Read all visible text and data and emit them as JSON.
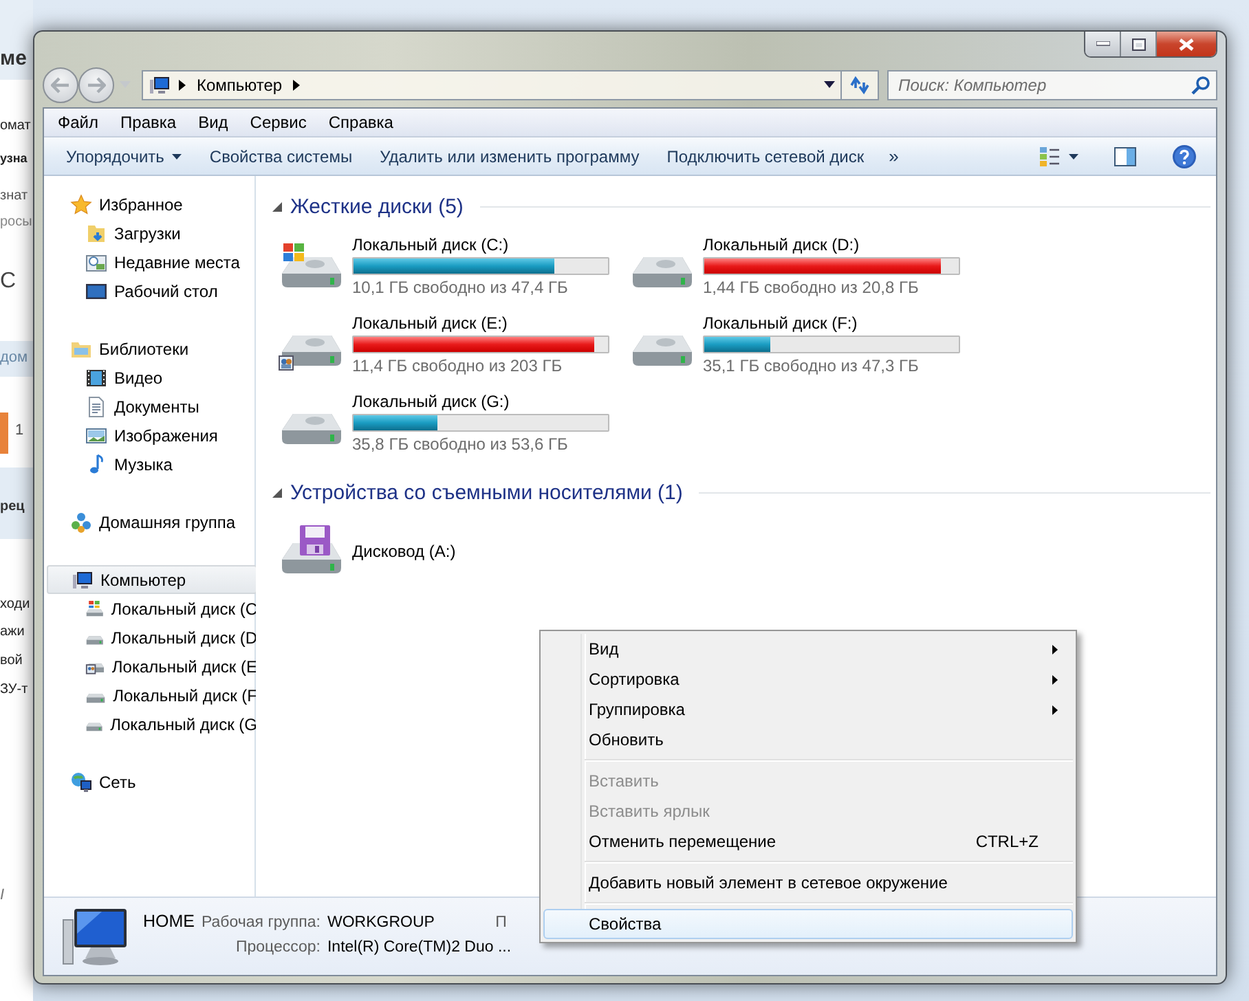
{
  "background_page": {
    "fragments": [
      "ме",
      "омат",
      "узна",
      "знат",
      "росы",
      "С",
      "дом",
      "1",
      "рец",
      "ходи",
      "ажи",
      "вой",
      "ЗУ-т",
      "I"
    ]
  },
  "window": {
    "address": {
      "breadcrumbs": [
        "Компьютер"
      ]
    },
    "search": {
      "placeholder": "Поиск: Компьютер"
    },
    "menu_bar": [
      "Файл",
      "Правка",
      "Вид",
      "Сервис",
      "Справка"
    ],
    "toolbar": [
      {
        "kind": "dropdown",
        "label": "Упорядочить"
      },
      {
        "kind": "button",
        "label": "Свойства системы"
      },
      {
        "kind": "button",
        "label": "Удалить или изменить программу"
      },
      {
        "kind": "button",
        "label": "Подключить сетевой диск"
      },
      {
        "kind": "overflow",
        "label": "»"
      }
    ],
    "sidebar": {
      "items": [
        {
          "kind": "favorites",
          "label": "Избранное",
          "selected": false,
          "children": [
            {
              "kind": "downloads",
              "label": "Загрузки",
              "selected": false
            },
            {
              "kind": "recent",
              "label": "Недавние места",
              "selected": false
            },
            {
              "kind": "desktop",
              "label": "Рабочий стол",
              "selected": false
            }
          ]
        },
        {
          "kind": "libraries",
          "label": "Библиотеки",
          "selected": false,
          "children": [
            {
              "kind": "video",
              "label": "Видео",
              "selected": false
            },
            {
              "kind": "documents",
              "label": "Документы",
              "selected": false
            },
            {
              "kind": "pictures",
              "label": "Изображения",
              "selected": false
            },
            {
              "kind": "music",
              "label": "Музыка",
              "selected": false
            }
          ]
        },
        {
          "kind": "homegroup",
          "label": "Домашняя группа",
          "selected": false
        },
        {
          "kind": "computer",
          "label": "Компьютер",
          "selected": true,
          "children": [
            {
              "kind": "system-drive",
              "label": "Локальный диск (C",
              "selected": false
            },
            {
              "kind": "drive",
              "label": "Локальный диск (D",
              "selected": false
            },
            {
              "kind": "shared-drive",
              "label": "Локальный диск (E",
              "selected": false
            },
            {
              "kind": "drive",
              "label": "Локальный диск (F",
              "selected": false
            },
            {
              "kind": "drive",
              "label": "Локальный диск (G",
              "selected": false
            }
          ]
        },
        {
          "kind": "network",
          "label": "Сеть",
          "selected": false
        }
      ]
    },
    "sections": [
      {
        "title": "Жесткие диски (5)",
        "expanded": true,
        "items": [
          {
            "kind": "system",
            "name": "Локальный диск (C:)",
            "level": 0.787,
            "warning": false,
            "free": "10,1 ГБ свободно из 47,4 ГБ"
          },
          {
            "kind": "plain",
            "name": "Локальный диск (D:)",
            "level": 0.931,
            "warning": true,
            "free": "1,44 ГБ свободно из 20,8 ГБ"
          },
          {
            "kind": "shared",
            "name": "Локальный диск (E:)",
            "level": 0.944,
            "warning": true,
            "free": "11,4 ГБ свободно из 203 ГБ"
          },
          {
            "kind": "plain",
            "name": "Локальный диск (F:)",
            "level": 0.258,
            "warning": false,
            "free": "35,1 ГБ свободно из 47,3 ГБ"
          },
          {
            "kind": "plain",
            "name": "Локальный диск (G:)",
            "level": 0.332,
            "warning": false,
            "free": "35,8 ГБ свободно из 53,6 ГБ"
          }
        ]
      },
      {
        "title": "Устройства со съемными носителями (1)",
        "expanded": true,
        "items": [
          {
            "kind": "floppy",
            "name": "Дисковод (A:)"
          }
        ]
      }
    ],
    "details": {
      "name": "HOME",
      "fields": [
        {
          "label": "Рабочая группа:",
          "value": "WORKGROUP"
        },
        {
          "label": "Процессор:",
          "value": "Intel(R) Core(TM)2 Duo ..."
        }
      ],
      "partial_label": "П"
    },
    "context_menu": {
      "items": [
        {
          "kind": "item",
          "label": "Вид",
          "submenu": true,
          "disabled": false,
          "selected": false
        },
        {
          "kind": "item",
          "label": "Сортировка",
          "submenu": true,
          "disabled": false,
          "selected": false
        },
        {
          "kind": "item",
          "label": "Группировка",
          "submenu": true,
          "disabled": false,
          "selected": false
        },
        {
          "kind": "item",
          "label": "Обновить",
          "submenu": false,
          "disabled": false,
          "selected": false
        },
        {
          "kind": "separator"
        },
        {
          "kind": "item",
          "label": "Вставить",
          "submenu": false,
          "disabled": true,
          "selected": false
        },
        {
          "kind": "item",
          "label": "Вставить ярлык",
          "submenu": false,
          "disabled": true,
          "selected": false
        },
        {
          "kind": "item",
          "label": "Отменить перемещение",
          "shortcut": "CTRL+Z",
          "submenu": false,
          "disabled": false,
          "selected": false
        },
        {
          "kind": "separator"
        },
        {
          "kind": "item",
          "label": "Добавить новый элемент в сетевое окружение",
          "submenu": false,
          "disabled": false,
          "selected": false
        },
        {
          "kind": "separator"
        },
        {
          "kind": "item",
          "label": "Свойства",
          "submenu": false,
          "disabled": false,
          "selected": true
        }
      ]
    }
  }
}
